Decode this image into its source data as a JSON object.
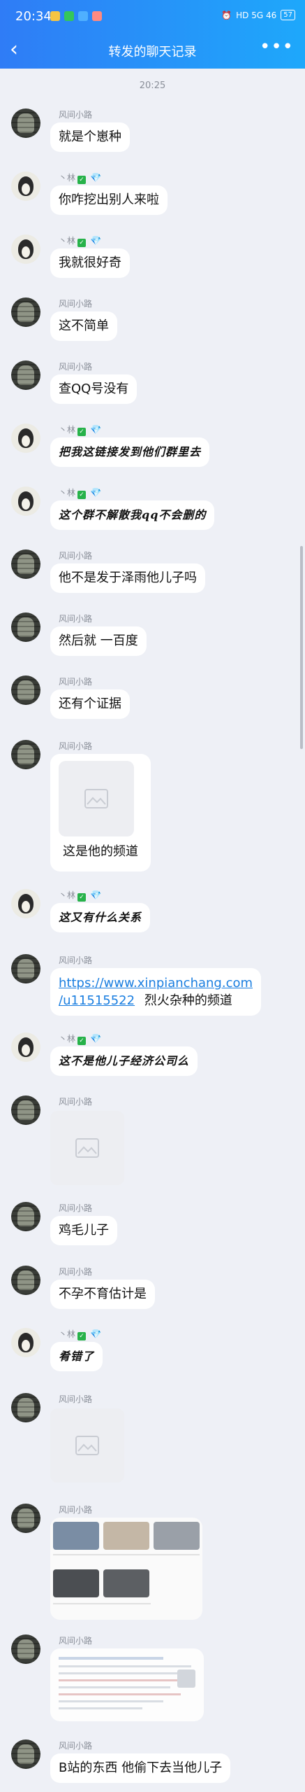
{
  "status_bar": {
    "time": "20:34",
    "network": "HD 5G 46",
    "battery": "57"
  },
  "header": {
    "title": "转发的聊天记录",
    "back_icon": "chevron-left-icon",
    "more_icon": "more-dots-icon"
  },
  "chat": {
    "timestamp": "20:25",
    "sender_a": "风间小路",
    "sender_b": "丶林",
    "messages": [
      {
        "from": "sender_a",
        "text": "就是个崽种"
      },
      {
        "from": "sender_b",
        "text": "你咋挖出别人来啦"
      },
      {
        "from": "sender_b",
        "text": "我就很好奇"
      },
      {
        "from": "sender_a",
        "text": "这不简单"
      },
      {
        "from": "sender_a",
        "text": "查QQ号没有"
      },
      {
        "from": "sender_b",
        "text": "把我这链接发到他们群里去"
      },
      {
        "from": "sender_b",
        "text": "这个群不解散我qq不会删的"
      },
      {
        "from": "sender_a",
        "text": "他不是发于泽雨他儿子吗"
      },
      {
        "from": "sender_a",
        "text": "然后就 一百度"
      },
      {
        "from": "sender_a",
        "text": "还有个证据"
      },
      {
        "from": "sender_a",
        "type": "image_caption",
        "text": "这是他的频道"
      },
      {
        "from": "sender_b",
        "text": "这又有什么关系"
      },
      {
        "from": "sender_a",
        "type": "link",
        "link_line1": "https://www.xinpianchang.com",
        "link_line2": "/u11515522",
        "text": "烈火杂种的频道"
      },
      {
        "from": "sender_b",
        "text": "这不是他儿子经济公司么"
      },
      {
        "from": "sender_a",
        "type": "image"
      },
      {
        "from": "sender_a",
        "text": "鸡毛儿子"
      },
      {
        "from": "sender_a",
        "text": "不孕不育估计是"
      },
      {
        "from": "sender_b",
        "text": "肴错了"
      },
      {
        "from": "sender_a",
        "type": "image"
      },
      {
        "from": "sender_a",
        "type": "screenshot_grid"
      },
      {
        "from": "sender_a",
        "type": "screenshot_doc"
      },
      {
        "from": "sender_a",
        "text": "B站的东西 他偷下去当他儿子"
      }
    ]
  }
}
